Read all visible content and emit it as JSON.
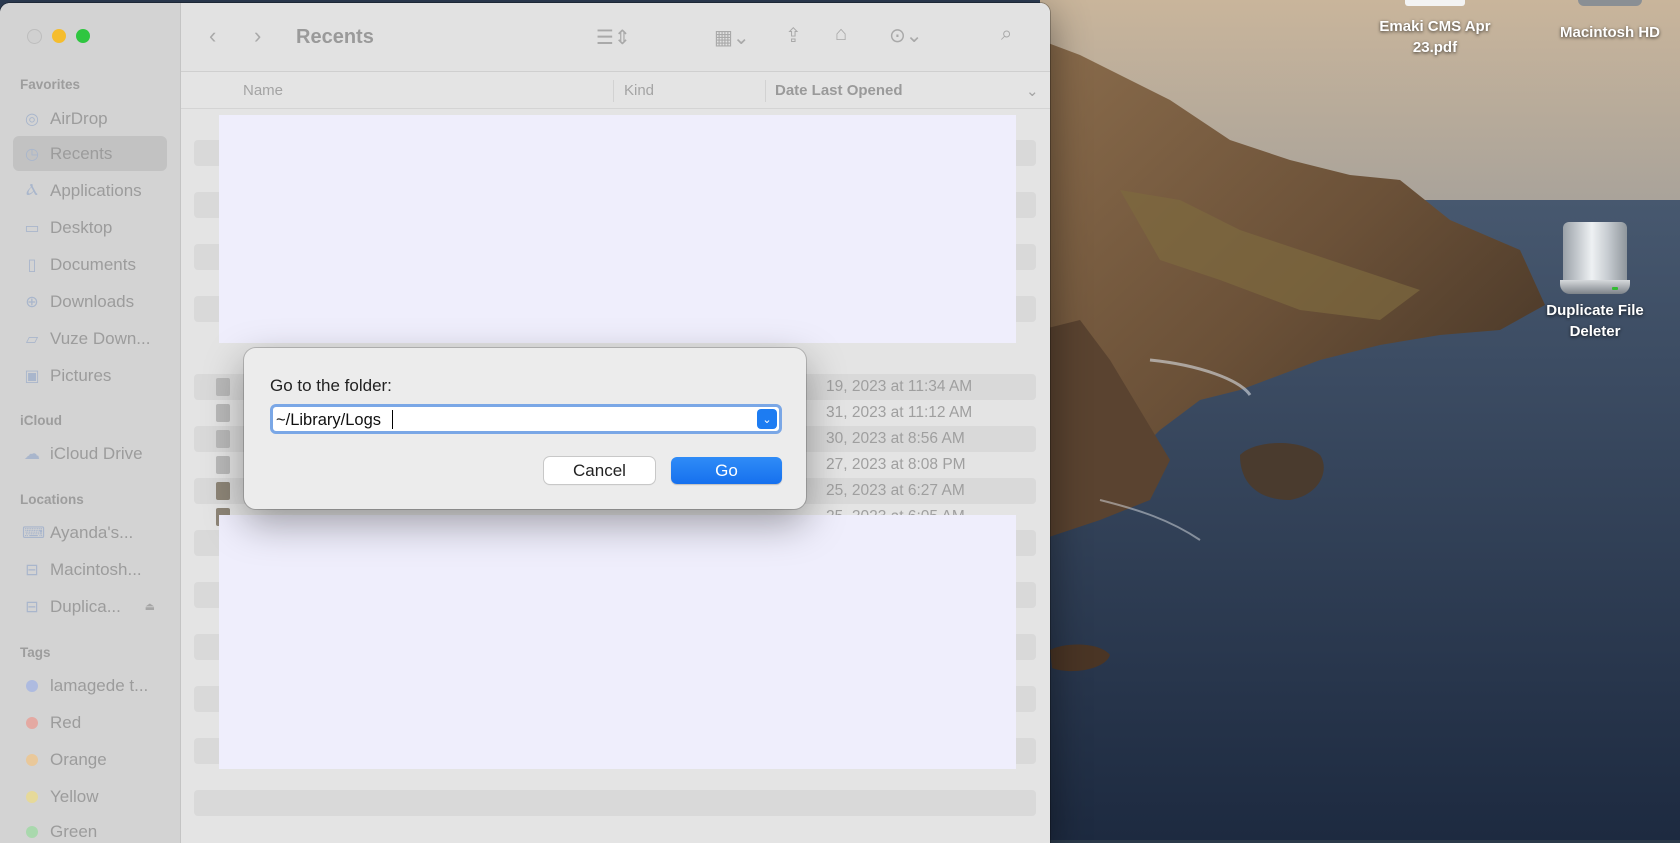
{
  "window": {
    "title": "Recents"
  },
  "sidebar": {
    "sections": [
      {
        "title": "Favorites",
        "items": [
          {
            "label": "AirDrop",
            "icon": "airdrop-icon"
          },
          {
            "label": "Recents",
            "icon": "clock-icon",
            "active": true
          },
          {
            "label": "Applications",
            "icon": "applications-icon"
          },
          {
            "label": "Desktop",
            "icon": "desktop-icon"
          },
          {
            "label": "Documents",
            "icon": "document-icon"
          },
          {
            "label": "Downloads",
            "icon": "download-icon"
          },
          {
            "label": "Vuze Down...",
            "icon": "folder-icon"
          },
          {
            "label": "Pictures",
            "icon": "pictures-icon"
          }
        ]
      },
      {
        "title": "iCloud",
        "items": [
          {
            "label": "iCloud Drive",
            "icon": "cloud-icon"
          }
        ]
      },
      {
        "title": "Locations",
        "items": [
          {
            "label": "Ayanda's...",
            "icon": "laptop-icon"
          },
          {
            "label": "Macintosh...",
            "icon": "drive-icon"
          },
          {
            "label": "Duplica...",
            "icon": "drive-icon",
            "eject": true
          }
        ]
      },
      {
        "title": "Tags",
        "items": [
          {
            "label": "lamagede t...",
            "color": "#4a7fe0"
          },
          {
            "label": "Red",
            "color": "#e25a4e"
          },
          {
            "label": "Orange",
            "color": "#f0a33a"
          },
          {
            "label": "Yellow",
            "color": "#f2d23c"
          },
          {
            "label": "Green",
            "color": "#4fbf5a"
          }
        ]
      }
    ]
  },
  "columns": {
    "name": "Name",
    "kind": "Kind",
    "date": "Date Last Opened"
  },
  "rows": [
    {
      "date": "19, 2023 at 11:34 AM"
    },
    {
      "date": "31, 2023 at 11:12 AM"
    },
    {
      "date": "30, 2023 at 8:56 AM"
    },
    {
      "date": "27, 2023 at 8:08 PM"
    },
    {
      "date": "25, 2023 at 6:27 AM"
    },
    {
      "date": "25, 2023 at 6:05 AM"
    }
  ],
  "dialog": {
    "label": "Go to the folder:",
    "value": "~/Library/Logs",
    "cancel": "Cancel",
    "go": "Go"
  },
  "desktop": {
    "icons": [
      {
        "label_line1": "Emaki CMS Apr",
        "label_line2": "23.pdf"
      },
      {
        "label_line1": "Macintosh HD",
        "label_line2": ""
      },
      {
        "label_line1": "Duplicate File",
        "label_line2": "Deleter"
      }
    ]
  },
  "colors": {
    "accent": "#1d7cf2",
    "overlay": "#efeefc"
  }
}
